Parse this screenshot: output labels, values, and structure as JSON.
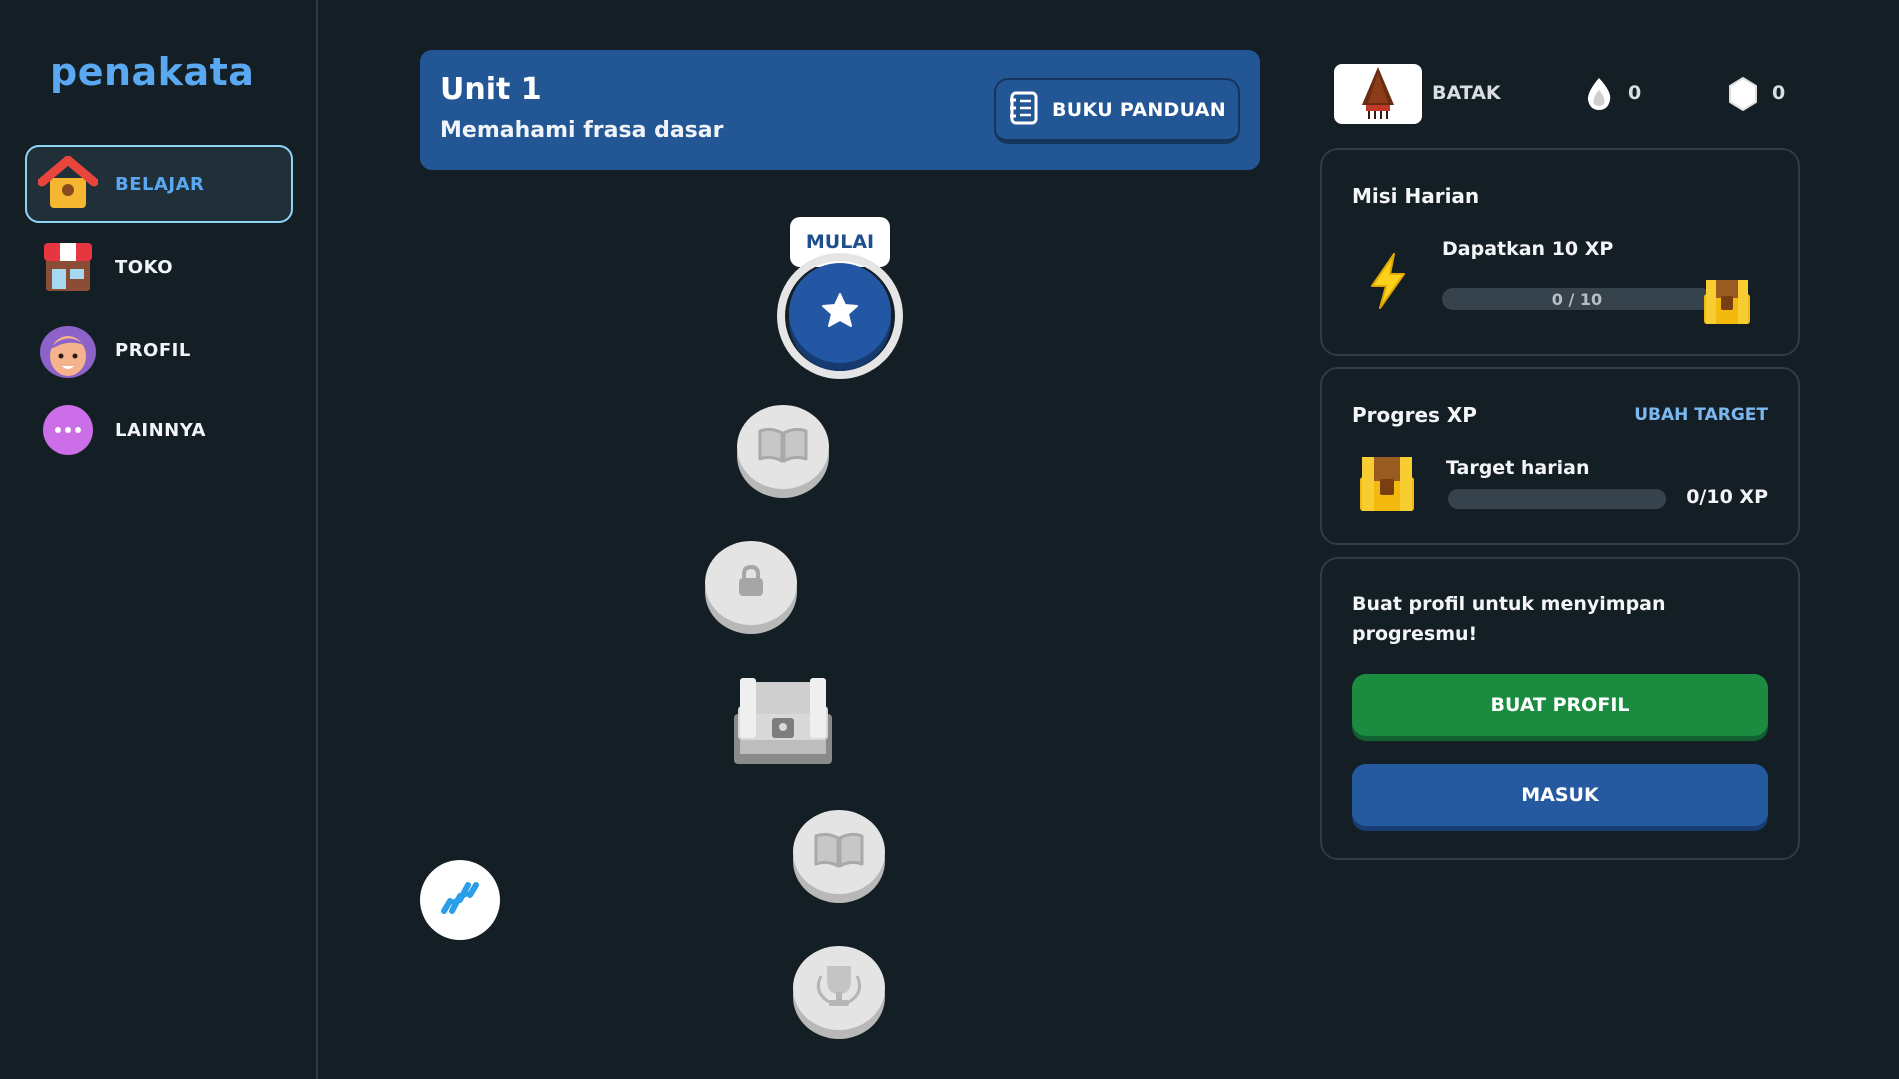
{
  "app": {
    "logo": "penakata"
  },
  "sidebar": {
    "items": [
      {
        "label": "BELAJAR",
        "icon": "home-icon",
        "active": true
      },
      {
        "label": "TOKO",
        "icon": "shop-icon",
        "active": false
      },
      {
        "label": "PROFIL",
        "icon": "profile-icon",
        "active": false
      },
      {
        "label": "LAINNYA",
        "icon": "more-icon",
        "active": false
      }
    ]
  },
  "unit": {
    "title": "Unit 1",
    "subtitle": "Memahami frasa dasar",
    "guide_label": "BUKU PANDUAN"
  },
  "path": {
    "start_label": "MULAI",
    "nodes": [
      {
        "type": "star-icon",
        "state": "current"
      },
      {
        "type": "book-icon",
        "state": "locked"
      },
      {
        "type": "lock-icon",
        "state": "locked"
      },
      {
        "type": "chest-icon",
        "state": "locked"
      },
      {
        "type": "book-icon",
        "state": "locked"
      },
      {
        "type": "trophy-icon",
        "state": "locked"
      }
    ],
    "practice_icon": "dumbbell-icon"
  },
  "stats": {
    "language": "BATAK",
    "streak": "0",
    "gems": "0"
  },
  "daily_mission": {
    "title": "Misi Harian",
    "task": "Dapatkan 10 XP",
    "progress_text": "0 / 10",
    "progress": 0
  },
  "xp_progress": {
    "title": "Progres XP",
    "change_target": "UBAH TARGET",
    "label": "Target harian",
    "value": "0/10 XP",
    "progress": 0
  },
  "profile_prompt": {
    "text": "Buat profil untuk menyimpan progresmu!",
    "create_button": "BUAT PROFIL",
    "login_button": "MASUK"
  },
  "colors": {
    "background": "#141f25",
    "accent_blue": "#235695",
    "active_text": "#5aa8f2",
    "green": "#1b8c3f"
  }
}
